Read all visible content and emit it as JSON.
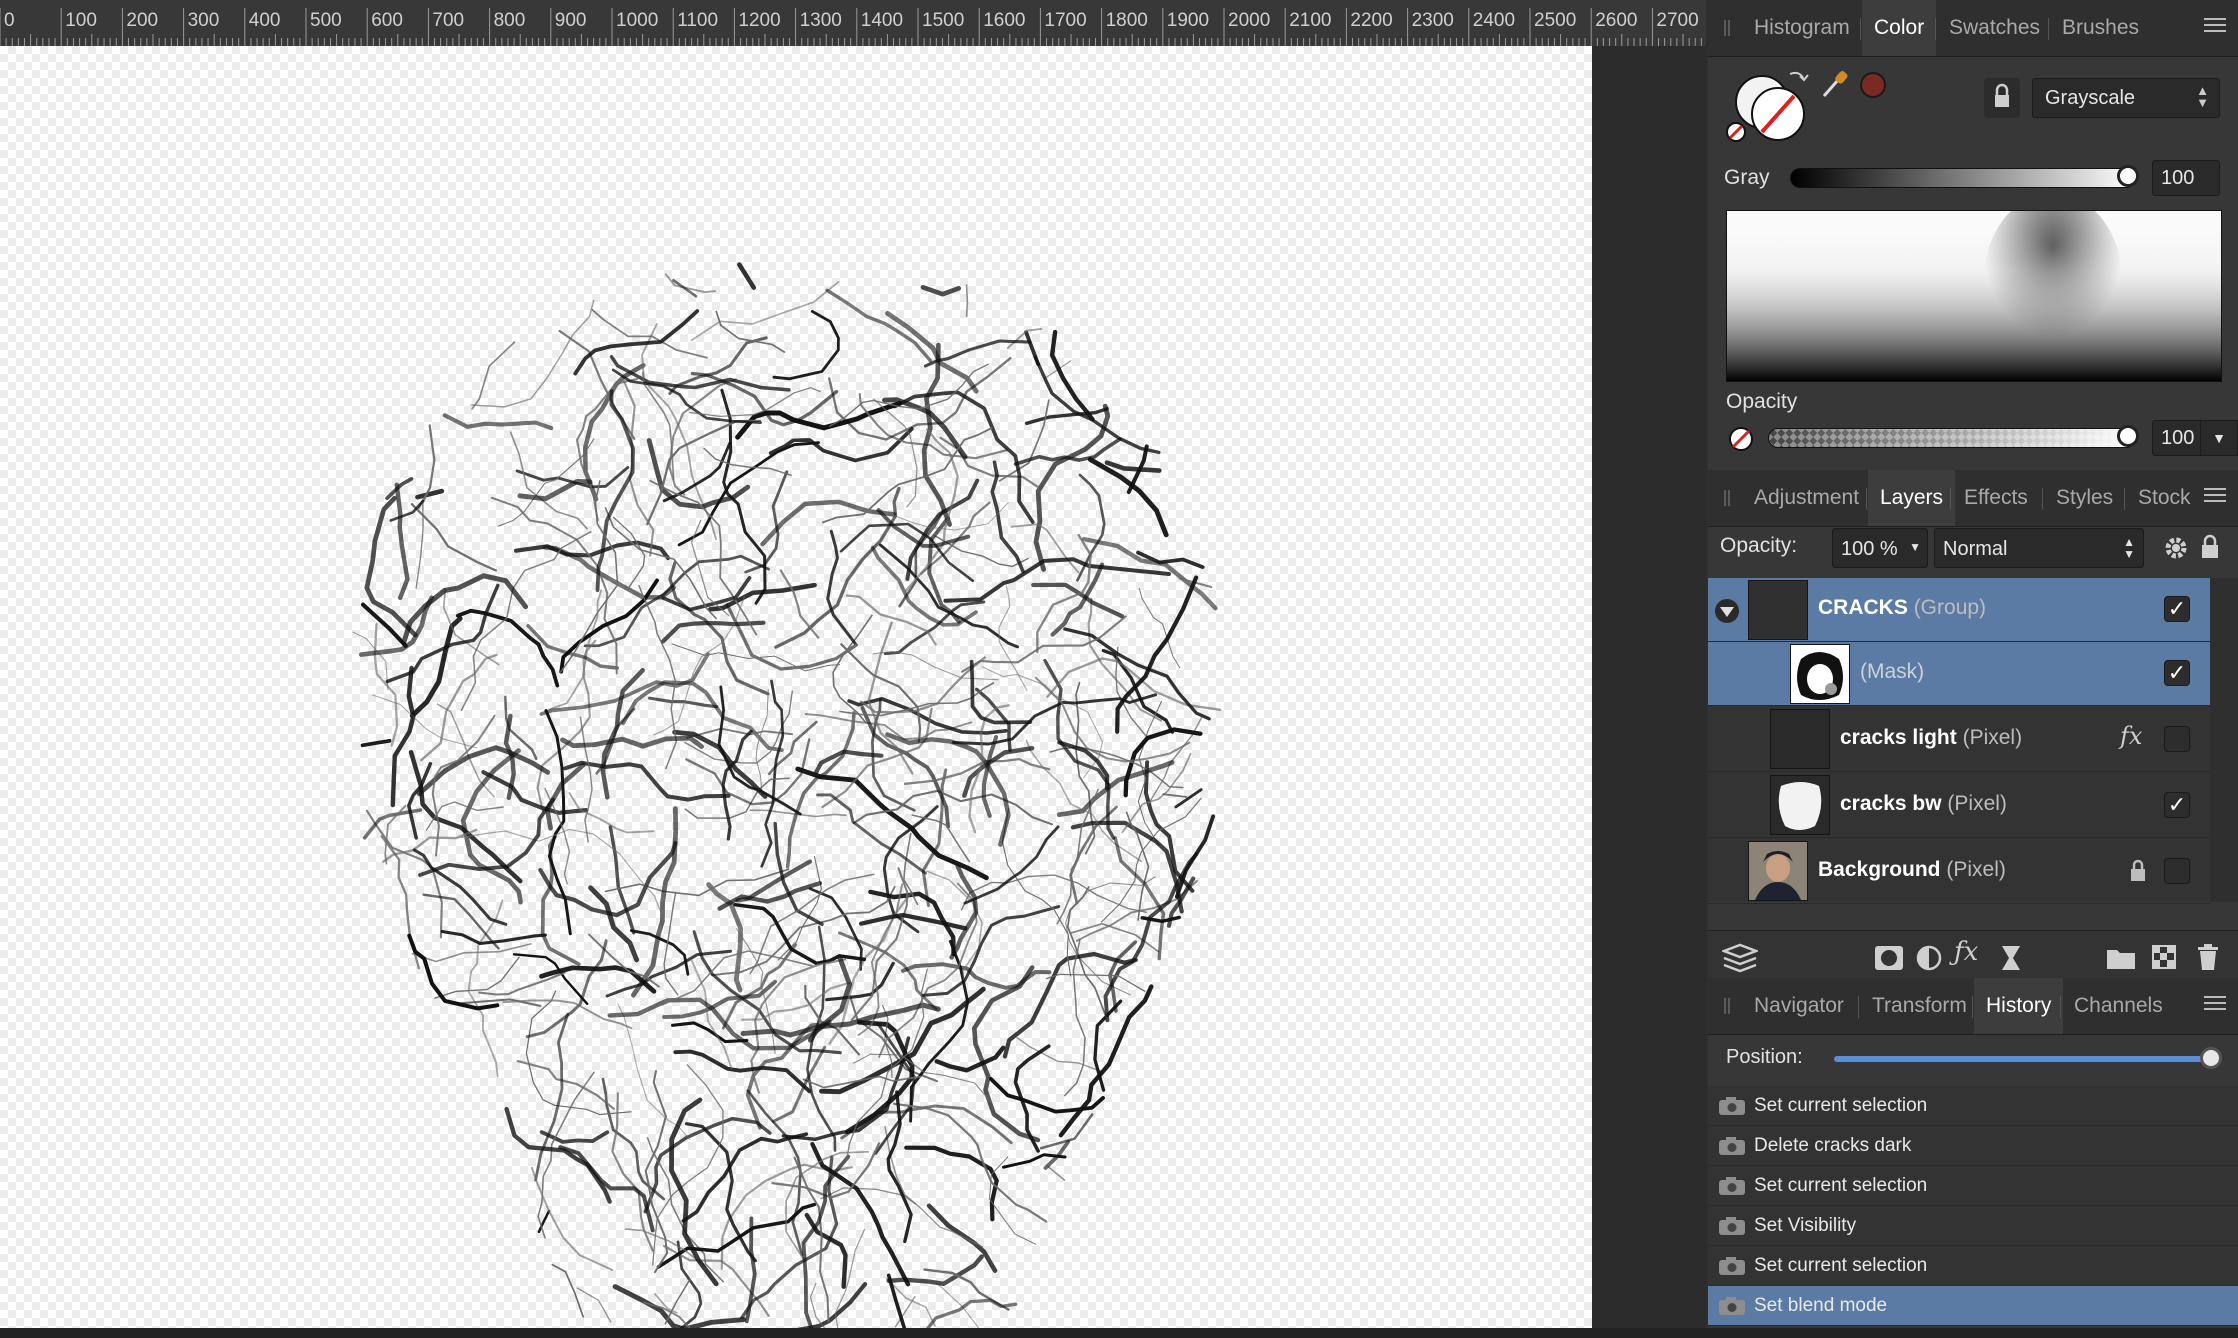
{
  "ruler": {
    "ticks": [
      "0",
      "100",
      "200",
      "300",
      "400",
      "500",
      "600",
      "700",
      "800",
      "900",
      "1000",
      "1100",
      "1200",
      "1300",
      "1400",
      "1500",
      "1600",
      "1700",
      "1800",
      "1900",
      "2000",
      "2100",
      "2200",
      "2300",
      "2400",
      "2500",
      "2600",
      "2700"
    ]
  },
  "color_panel": {
    "tabs": [
      "Histogram",
      "Color",
      "Swatches",
      "Brushes"
    ],
    "active_tab": "Color",
    "mode_select": "Grayscale",
    "gray_label": "Gray",
    "gray_value": "100",
    "opacity_label": "Opacity",
    "opacity_value": "100 %"
  },
  "layers_panel": {
    "tabs": [
      "Adjustment",
      "Layers",
      "Effects",
      "Styles",
      "Stock"
    ],
    "active_tab": "Layers",
    "opacity_label": "Opacity:",
    "opacity_value": "100 %",
    "blend_mode": "Normal",
    "layers": [
      {
        "name": "CRACKS",
        "type": "(Group)",
        "checked": true,
        "selected": true
      },
      {
        "name": "",
        "type": "(Mask)",
        "checked": true,
        "selected": true
      },
      {
        "name": "cracks light",
        "type": "(Pixel)",
        "checked": false,
        "selected": false,
        "fx": "fx"
      },
      {
        "name": "cracks bw",
        "type": "(Pixel)",
        "checked": true,
        "selected": false
      },
      {
        "name": "Background",
        "type": "(Pixel)",
        "checked": false,
        "selected": false,
        "locked": true
      }
    ]
  },
  "history_panel": {
    "tabs": [
      "Navigator",
      "Transform",
      "History",
      "Channels"
    ],
    "active_tab": "History",
    "position_label": "Position:",
    "position_fraction": 1.0,
    "items": [
      "Set current selection",
      "Delete cracks dark",
      "Set current selection",
      "Set Visibility",
      "Set current selection",
      "Set blend mode"
    ],
    "selected_index": 5
  },
  "colors": {
    "selection": "#5b7ba4",
    "panel_bg": "#373737",
    "accent_swatch": "#7a2a22"
  }
}
